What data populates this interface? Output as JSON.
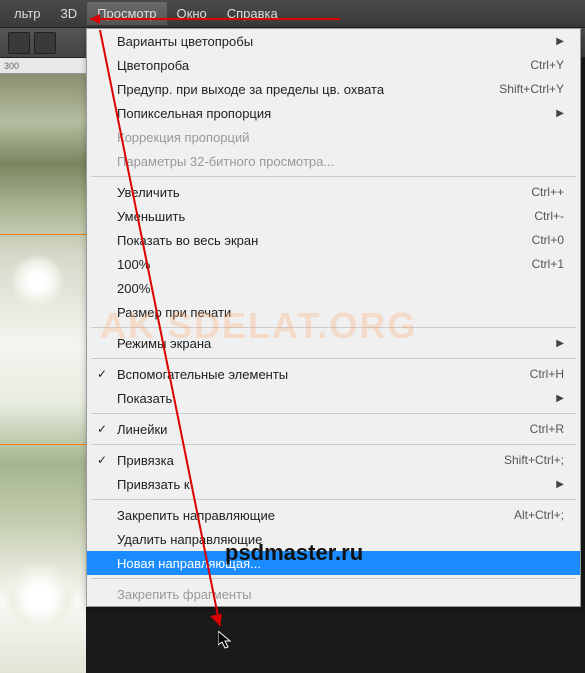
{
  "menubar": {
    "items": [
      "льтр",
      "3D",
      "Просмотр",
      "Окно",
      "Справка"
    ],
    "activeIndex": 2
  },
  "ruler": {
    "mark": "300"
  },
  "dropdown": {
    "groups": [
      [
        {
          "label": "Варианты цветопробы",
          "submenu": true
        },
        {
          "label": "Цветопроба",
          "shortcut": "Ctrl+Y"
        },
        {
          "label": "Предупр. при выходе за пределы цв. охвата",
          "shortcut": "Shift+Ctrl+Y"
        },
        {
          "label": "Попиксельная пропорция",
          "submenu": true
        },
        {
          "label": "Коррекция пропорций",
          "disabled": true
        },
        {
          "label": "Параметры 32-битного просмотра...",
          "disabled": true
        }
      ],
      [
        {
          "label": "Увеличить",
          "shortcut": "Ctrl++"
        },
        {
          "label": "Уменьшить",
          "shortcut": "Ctrl+-"
        },
        {
          "label": "Показать во весь экран",
          "shortcut": "Ctrl+0"
        },
        {
          "label": "100%",
          "shortcut": "Ctrl+1"
        },
        {
          "label": "200%"
        },
        {
          "label": "Размер при печати"
        }
      ],
      [
        {
          "label": "Режимы экрана",
          "submenu": true
        }
      ],
      [
        {
          "label": "Вспомогательные элементы",
          "shortcut": "Ctrl+H",
          "checked": true
        },
        {
          "label": "Показать",
          "submenu": true
        }
      ],
      [
        {
          "label": "Линейки",
          "shortcut": "Ctrl+R",
          "checked": true
        }
      ],
      [
        {
          "label": "Привязка",
          "shortcut": "Shift+Ctrl+;",
          "checked": true
        },
        {
          "label": "Привязать к",
          "submenu": true
        }
      ],
      [
        {
          "label": "Закрепить направляющие",
          "shortcut": "Alt+Ctrl+;"
        },
        {
          "label": "Удалить направляющие"
        },
        {
          "label": "Новая направляющая...",
          "highlighted": true
        }
      ],
      [
        {
          "label": "Закрепить фрагменты",
          "disabled": true
        }
      ]
    ]
  },
  "watermarks": {
    "bg": "AK SDELAT.ORG",
    "fg": "psdmaster.ru"
  }
}
